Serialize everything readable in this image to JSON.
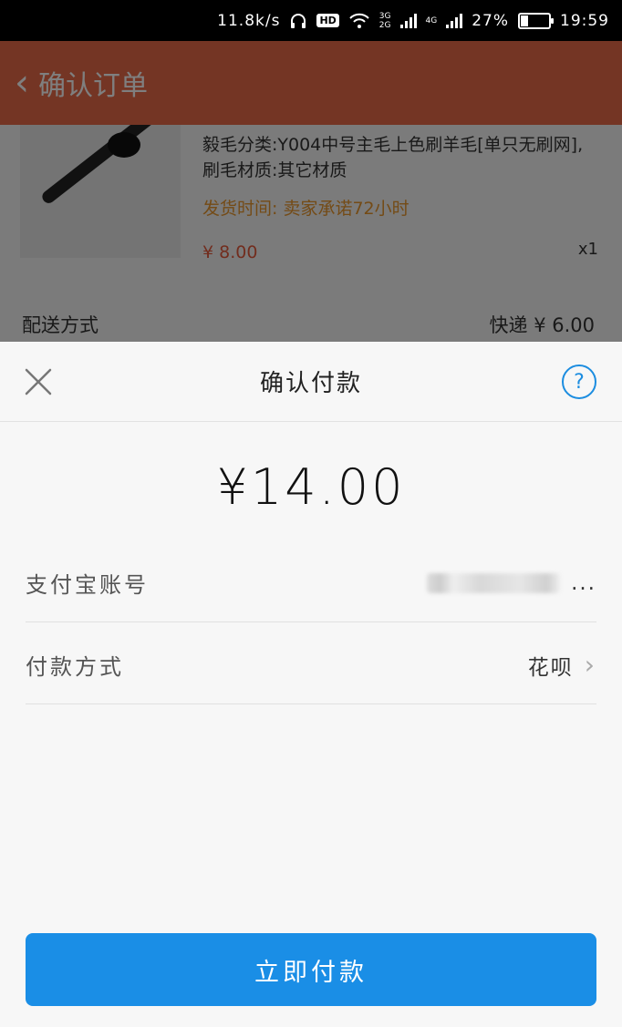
{
  "status_bar": {
    "speed": "11.8k/s",
    "hd": "HD",
    "net_3g": "3G",
    "net_2g": "2G",
    "net_4g": "4G",
    "battery": "27%",
    "battery_level": 0.27,
    "time": "19:59"
  },
  "background_page": {
    "header_title": "确认订单",
    "product_spec": "毅毛分类:Y004中号主毛上色刷羊毛[单只无刷网],刷毛材质:其它材质",
    "ship_time": "发货时间: 卖家承诺72小时",
    "price": "¥ 8.00",
    "quantity": "x1",
    "delivery_label": "配送方式",
    "delivery_value": "快递 ¥ 6.00"
  },
  "sheet": {
    "title": "确认付款",
    "amount": "¥14.00",
    "account_label": "支付宝账号",
    "account_suffix": "...",
    "method_label": "付款方式",
    "method_value": "花呗",
    "pay_button": "立即付款",
    "accent_color": "#1a8ee6"
  },
  "icons": {
    "close": "close-icon",
    "help": "help-icon",
    "chevron": "chevron-right-icon",
    "back": "back-icon"
  }
}
